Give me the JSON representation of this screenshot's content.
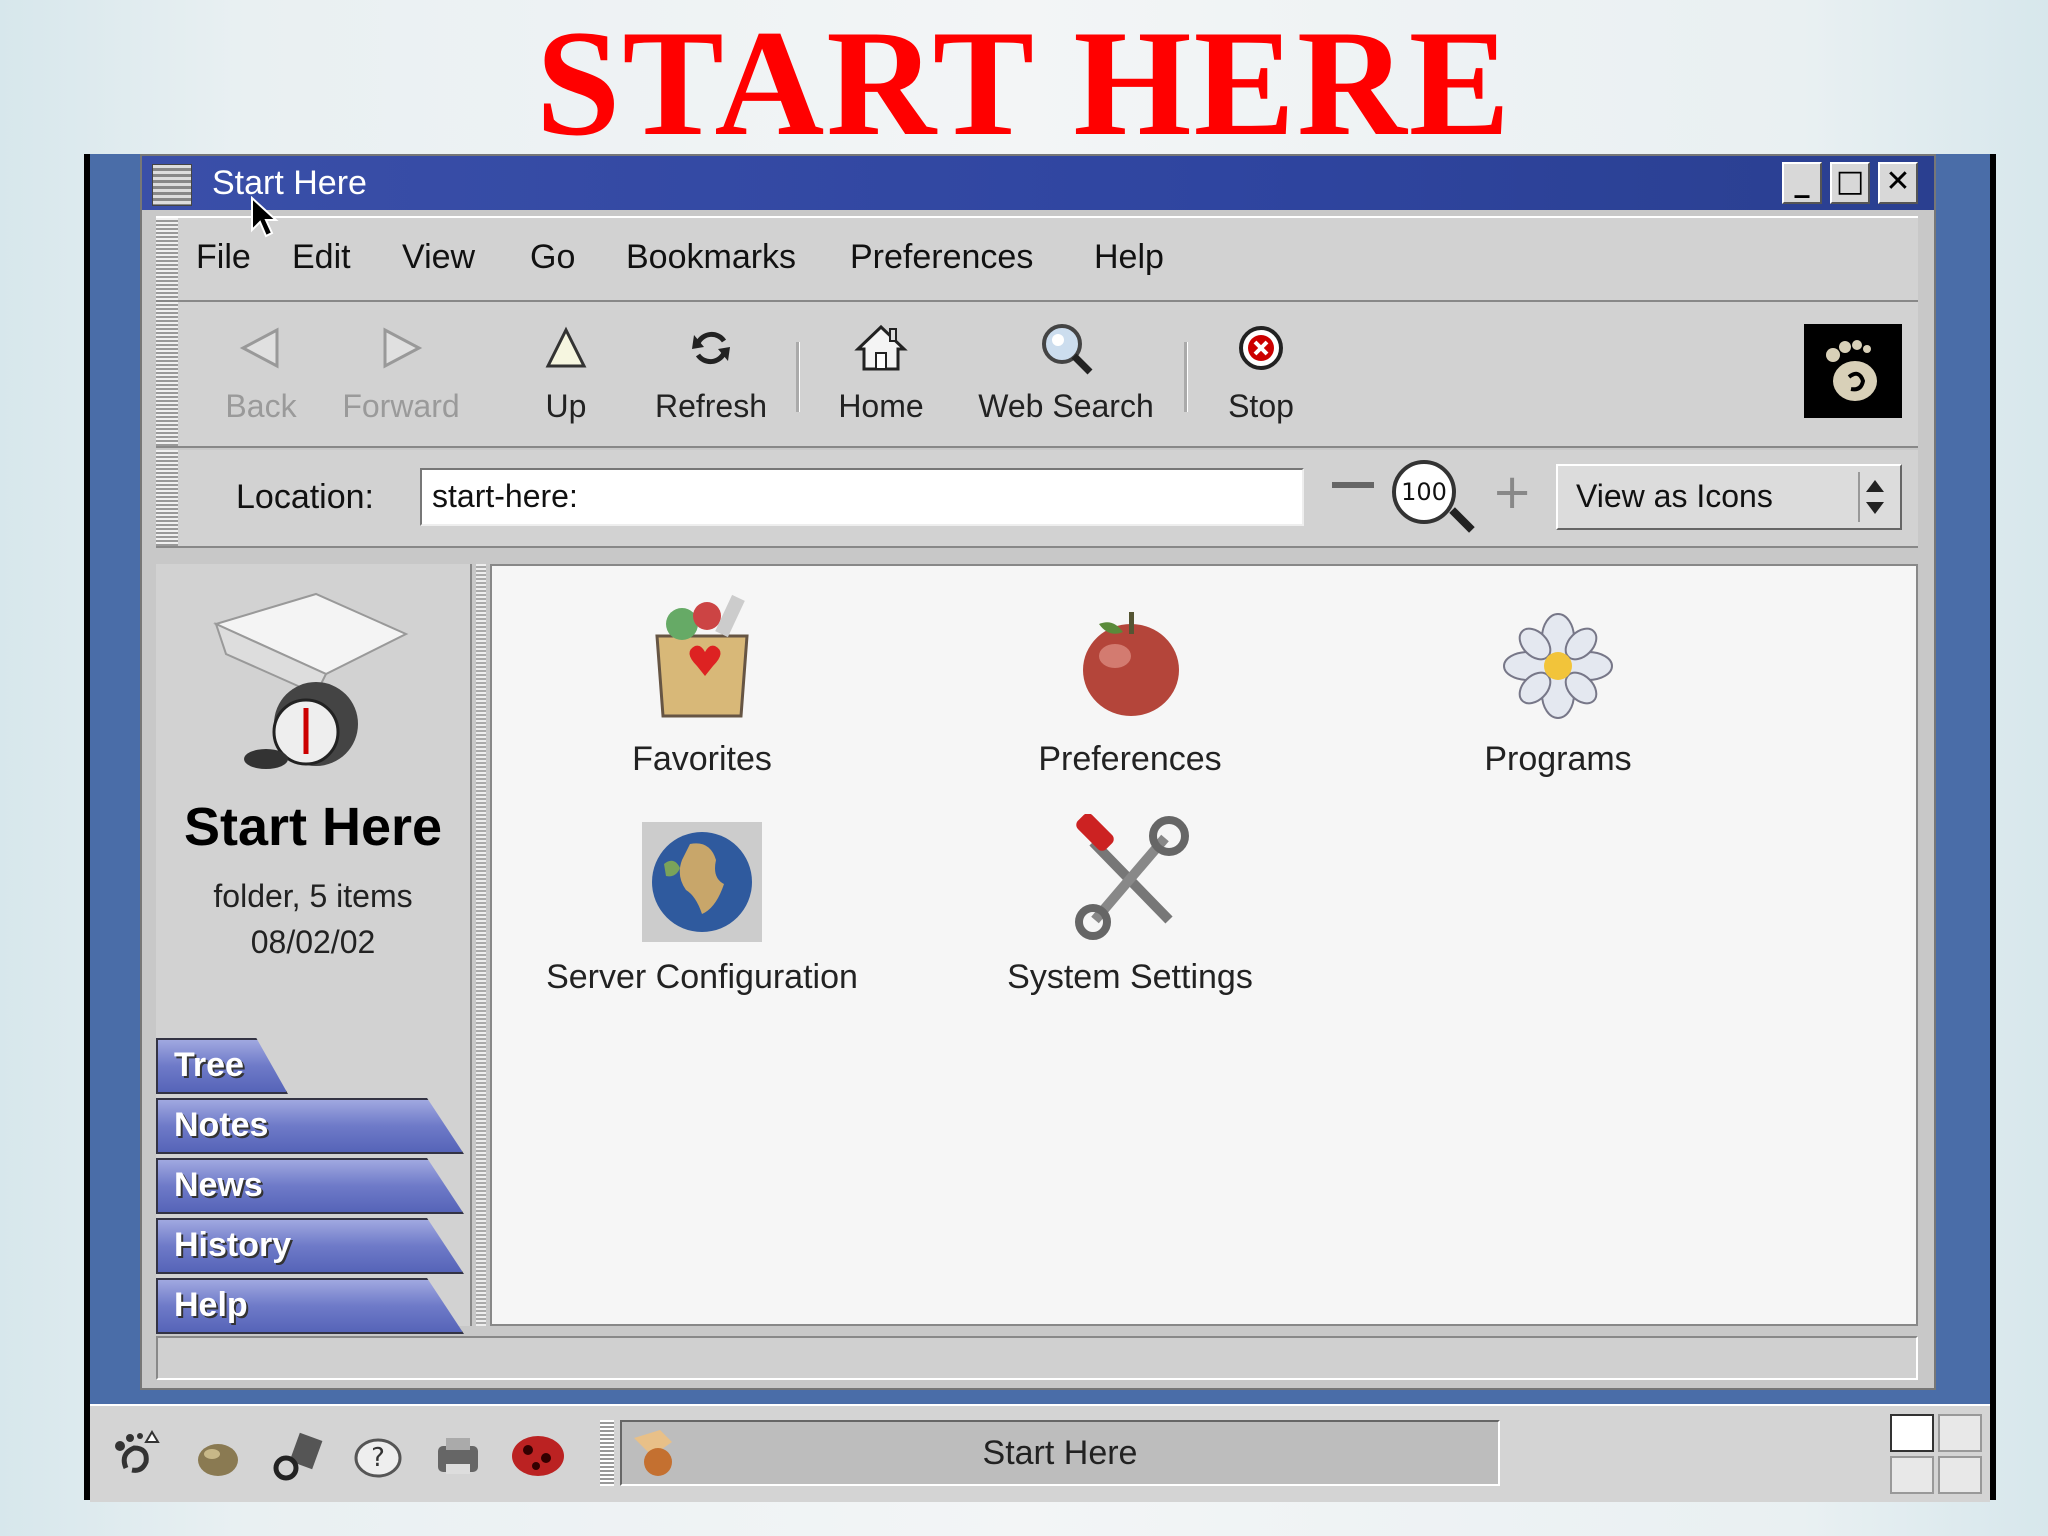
{
  "slide": {
    "title": "START HERE"
  },
  "window": {
    "title": "Start Here",
    "controls": {
      "minimize": "_",
      "maximize": "□",
      "close": "✕"
    }
  },
  "menubar": {
    "items": [
      {
        "label": "File",
        "underline": "F"
      },
      {
        "label": "Edit",
        "underline": "E"
      },
      {
        "label": "View",
        "underline": "V"
      },
      {
        "label": "Go",
        "underline": "G"
      },
      {
        "label": "Bookmarks",
        "underline": "B"
      },
      {
        "label": "Preferences",
        "underline": "P"
      },
      {
        "label": "Help",
        "underline": "H"
      }
    ]
  },
  "toolbar": {
    "buttons": [
      {
        "label": "Back",
        "icon": "back-arrow-icon",
        "enabled": false
      },
      {
        "label": "Forward",
        "icon": "forward-arrow-icon",
        "enabled": false
      },
      {
        "label": "Up",
        "icon": "up-arrow-icon",
        "enabled": true
      },
      {
        "label": "Refresh",
        "icon": "refresh-icon",
        "enabled": true
      },
      {
        "label": "Home",
        "icon": "home-icon",
        "enabled": true
      },
      {
        "label": "Web Search",
        "icon": "magnifier-globe-icon",
        "enabled": true
      },
      {
        "label": "Stop",
        "icon": "stop-icon",
        "enabled": true
      }
    ]
  },
  "location": {
    "label": "Location:",
    "value": "start-here:",
    "zoom": "100",
    "view_mode": "View as Icons"
  },
  "sidebar": {
    "title": "Start Here",
    "info_type": "folder, 5 items",
    "info_date": "08/02/02",
    "tabs": [
      "Tree",
      "Notes",
      "News",
      "History",
      "Help"
    ]
  },
  "content": {
    "items": [
      {
        "label": "Favorites",
        "icon": "favorites-bag-icon"
      },
      {
        "label": "Preferences",
        "icon": "apple-icon"
      },
      {
        "label": "Programs",
        "icon": "flower-icon"
      },
      {
        "label": "Server Configuration",
        "icon": "globe-icon"
      },
      {
        "label": "System Settings",
        "icon": "tools-icon"
      }
    ]
  },
  "statusbar": {
    "text": ""
  },
  "panel": {
    "task": "Start Here",
    "launchers": [
      "gnome-foot-icon",
      "stone-icon",
      "tools-launcher-icon",
      "help-icon",
      "printer-icon",
      "game-icon"
    ]
  }
}
